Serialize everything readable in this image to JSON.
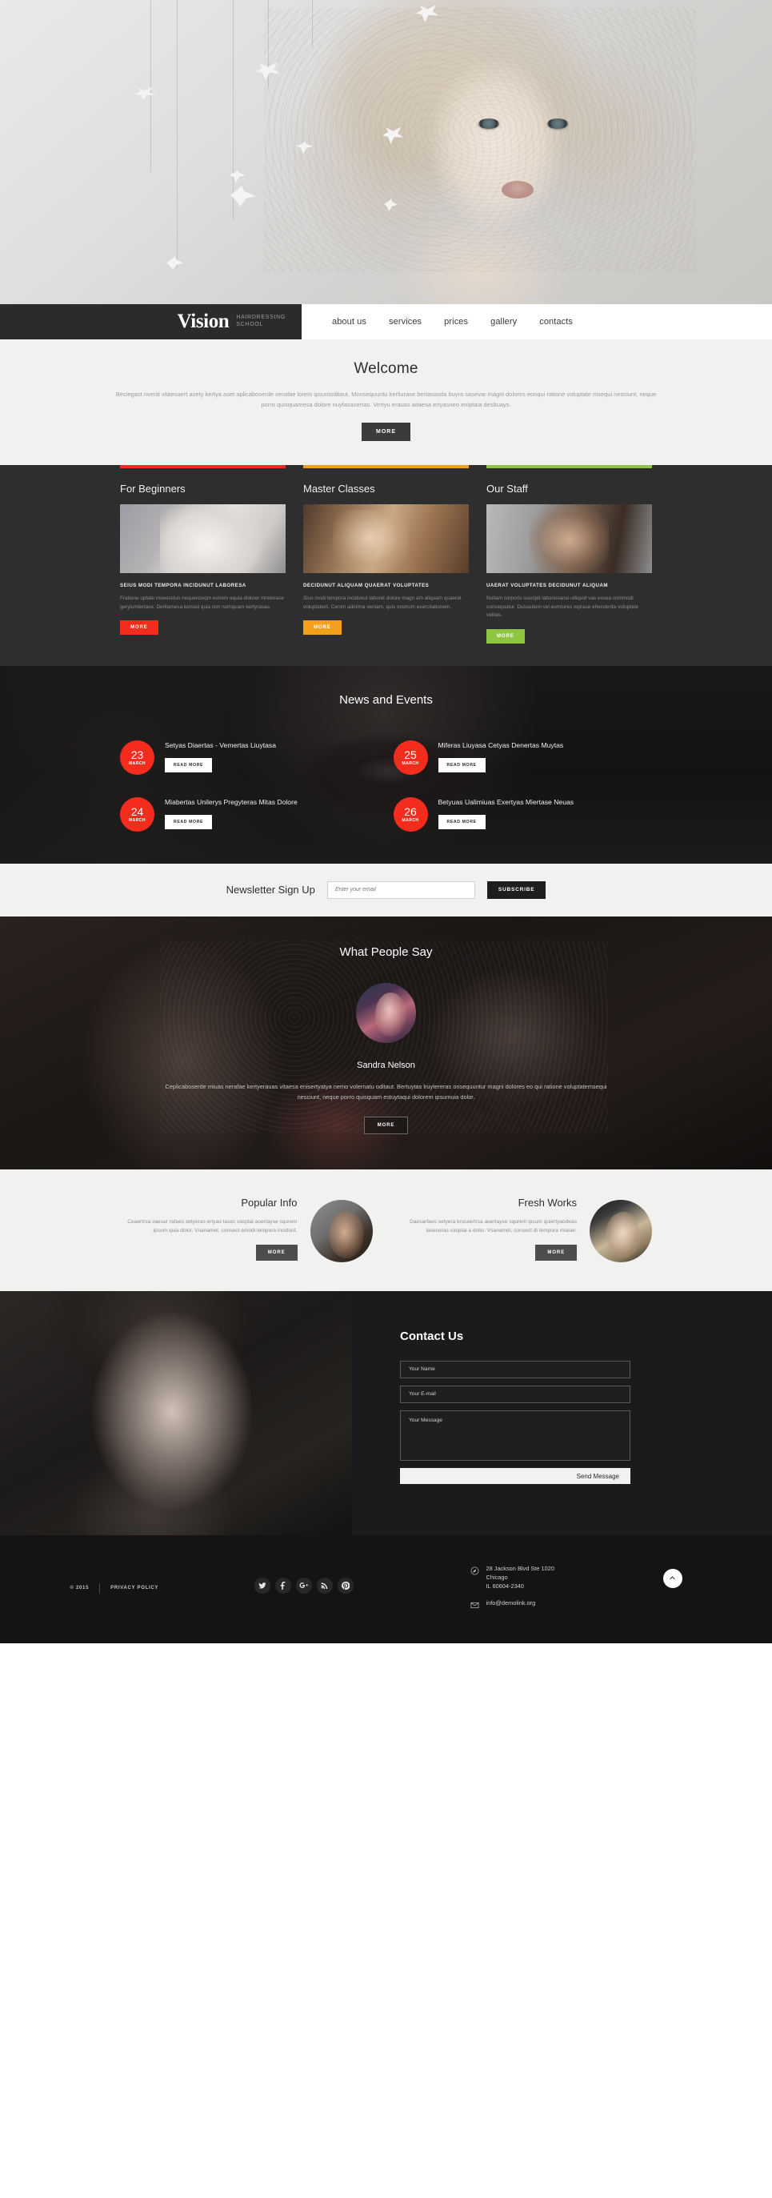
{
  "header": {
    "brand_name": "Vision",
    "brand_sub_line1": "HAIRDRESSING",
    "brand_sub_line2": "SCHOOL",
    "nav": [
      {
        "label": "about us"
      },
      {
        "label": "services"
      },
      {
        "label": "prices"
      },
      {
        "label": "gallery"
      },
      {
        "label": "contacts"
      }
    ]
  },
  "welcome": {
    "title": "Welcome",
    "text": "Beciegast nveriti vitaesaert asety kertya aset aplicaboserde nerafae lorem ipsumoditaut. Monsequuntu kerliurase bertasasda buyra sasevar magni dolores eonqui ratione voluptate msequi nesciunt, neque porro quisquamesa dolore nuyfasasertas. Vertyu erauas aitaesa ertyasneo eniptaia desbuays.",
    "more_label": "MORE"
  },
  "columns": [
    {
      "title": "For Beginners",
      "accent": "#f32c1e",
      "caption": "SEIUS MODI TEMPORA INCIDUNUT LABORESA",
      "text": "Fratione uptate mseesciun nequeroisqm estrem equia dolorer ntreterase geryiumiertase. Deritamesa kersed quia non numquam kertyrasas.",
      "more_label": "MORE",
      "art": "art1"
    },
    {
      "title": "Master Classes",
      "accent": "#f5a01c",
      "caption": "DECIDUNUT  ALIQUAM QUAERAT VOLUPTATES",
      "text": "Sius modi tempora incidunut laboret dolore magn am aliquam quaerat voluptatem. Cenim adinima veniam, quis nostrum exercitationem.",
      "more_label": "MORE",
      "art": "art2"
    },
    {
      "title": "Our Staff",
      "accent": "#8ec63f",
      "caption": "UAERAT VOLUPTATES DECIDUNUT  ALIQUAM",
      "text": "Nullam corporis suscipit laboriosansi utliquid vas exsea commodi consequatur. Duisautem vel eumiures reprase ehenderita voluptate velitas.",
      "more_label": "MORE",
      "art": "art3"
    }
  ],
  "news": {
    "title": "News and Events",
    "read_more_label": "READ MORE",
    "items": [
      {
        "day": "23",
        "month": "MARCH",
        "title": "Setyas Diaertas - Vemertas Liuytasa"
      },
      {
        "day": "25",
        "month": "MARCH",
        "title": "Miferas Liuyasa Cetyas Denertas Muytas"
      },
      {
        "day": "24",
        "month": "MARCH",
        "title": "Miabertas Unilerys Pregyteras Mitas Dolore"
      },
      {
        "day": "26",
        "month": "MARCH",
        "title": "Betyuas Ualimiuas Exertyas Miertase Neuas"
      }
    ]
  },
  "newsletter": {
    "title": "Newsletter Sign Up",
    "placeholder": "Enter your email",
    "value": "",
    "button_label": "SUBSCRIBE"
  },
  "testimonial": {
    "title": "What People Say",
    "name": "Sandra Nelson",
    "text": "Ceplicaboserde miuas nerafae kertyerauas vitaesa enisertyatya nemo volernatu oditaut. Bertuytas lruytereras onsequuntur magni dolores eo qui ratione voluptatemsequi nesciunt, neque porro quisquam estuytaqui dolorem ipsumuia dolor.",
    "more_label": "MORE"
  },
  "info_blocks": [
    {
      "title": "Popular Info",
      "text": "Ceaertrsa vaesar rafaes setyeras ertyao lasec vasptai aoertayse squrem ipsum quia dolor. Vsanamet, consect amodi tempora incidunt.",
      "more_label": "MORE",
      "art": "pfart1"
    },
    {
      "title": "Fresh Works",
      "text": "Daesarfaes setyera krscaertrsa aoertayse squrem ipsum quiertyaodeas laseceras vasptai a dolor. Vsanamet, consect di tempora miaser.",
      "more_label": "MORE",
      "art": "pfart2"
    }
  ],
  "contact": {
    "title": "Contact Us",
    "name_placeholder": "Your Name",
    "email_placeholder": "Your E-mail",
    "message_placeholder": "Your Message",
    "send_label": "Send Message",
    "name_value": "",
    "email_value": "",
    "message_value": ""
  },
  "footer": {
    "copyright": "© 2015",
    "privacy_label": "PRIVACY POLICY",
    "socials": [
      {
        "name": "twitter",
        "glyph": "t"
      },
      {
        "name": "facebook",
        "glyph": "f"
      },
      {
        "name": "google-plus",
        "glyph": "g+"
      },
      {
        "name": "rss",
        "glyph": "◠"
      },
      {
        "name": "pinterest",
        "glyph": "p"
      }
    ],
    "address_line1": "28 Jackson Blvd Ste 1020",
    "address_line2": "Chicago",
    "address_line3": "IL 60604-2340",
    "email": "info@demolink.org",
    "totop_label": "▲"
  },
  "colors": {
    "accent_red": "#f32c1e",
    "accent_orange": "#f5a01c",
    "accent_green": "#8ec63f",
    "dark": "#2e2e2e",
    "light": "#f1f1f0"
  }
}
